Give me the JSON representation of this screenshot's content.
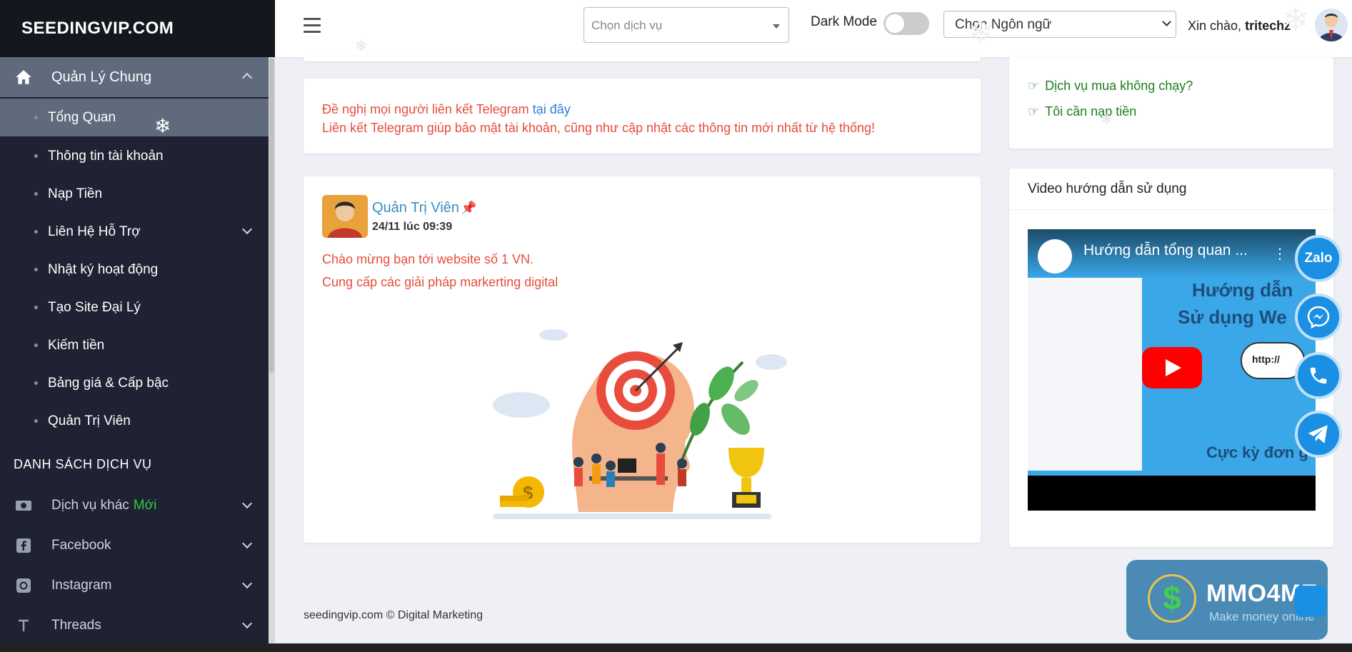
{
  "brand": "SEEDINGVIP.COM",
  "sidebar": {
    "main_item": "Quản Lý Chung",
    "sub_items": [
      {
        "label": "Tổng Quan"
      },
      {
        "label": "Thông tin tài khoản"
      },
      {
        "label": "Nạp Tiền"
      },
      {
        "label": "Liên Hệ Hỗ Trợ"
      },
      {
        "label": "Nhật ký hoạt động"
      },
      {
        "label": "Tạo Site Đại Lý"
      },
      {
        "label": "Kiếm tiền"
      },
      {
        "label": "Bảng giá & Cấp bậc"
      },
      {
        "label": "Quản Trị Viên"
      }
    ],
    "section_title": "DANH SÁCH DỊCH VỤ",
    "services": [
      {
        "label": "Dịch vụ khác",
        "badge": "Mới",
        "icon": "money-icon"
      },
      {
        "label": "Facebook",
        "icon": "facebook-icon"
      },
      {
        "label": "Instagram",
        "icon": "instagram-icon"
      },
      {
        "label": "Threads",
        "icon": "threads-icon"
      }
    ]
  },
  "topbar": {
    "service_placeholder": "Chọn dịch vụ",
    "dark_mode_label": "Dark Mode",
    "language_value": "Chọn Ngôn ngữ",
    "greeting": "Xin chào,",
    "username": "tritechz"
  },
  "notice": {
    "line1": "Đề nghị mọi người liên kết Telegram",
    "link": "tại đây",
    "line2": "Liên kết Telegram giúp bảo mật tài khoản, cũng như cập nhật các thông tin mới nhất từ hệ thống!"
  },
  "post": {
    "author": "Quản Trị Viên",
    "time": "24/11 lúc 09:39",
    "line1": "Chào mừng bạn tới website số 1 VN.",
    "line2": "Cung cấp các giải pháp markerting digital"
  },
  "help_links": [
    {
      "label": "Dịch vụ mua không chạy?"
    },
    {
      "label": "Tôi cần nạp tiền"
    }
  ],
  "video": {
    "card_title": "Video hướng dẫn sử dụng",
    "title": "Hướng dẫn tổng quan ...",
    "thumb_line1": "Hướng dẫn",
    "thumb_line2": "Sử dụng We",
    "thumb_line3": "Cực kỳ đơn g",
    "bubble": "http://"
  },
  "floating": [
    "Zalo",
    "messenger-icon",
    "phone-icon",
    "telegram-icon"
  ],
  "promo": {
    "name": "MMO4ME",
    "tagline": "Make money online"
  },
  "footer": "seedingvip.com © Digital Marketing"
}
